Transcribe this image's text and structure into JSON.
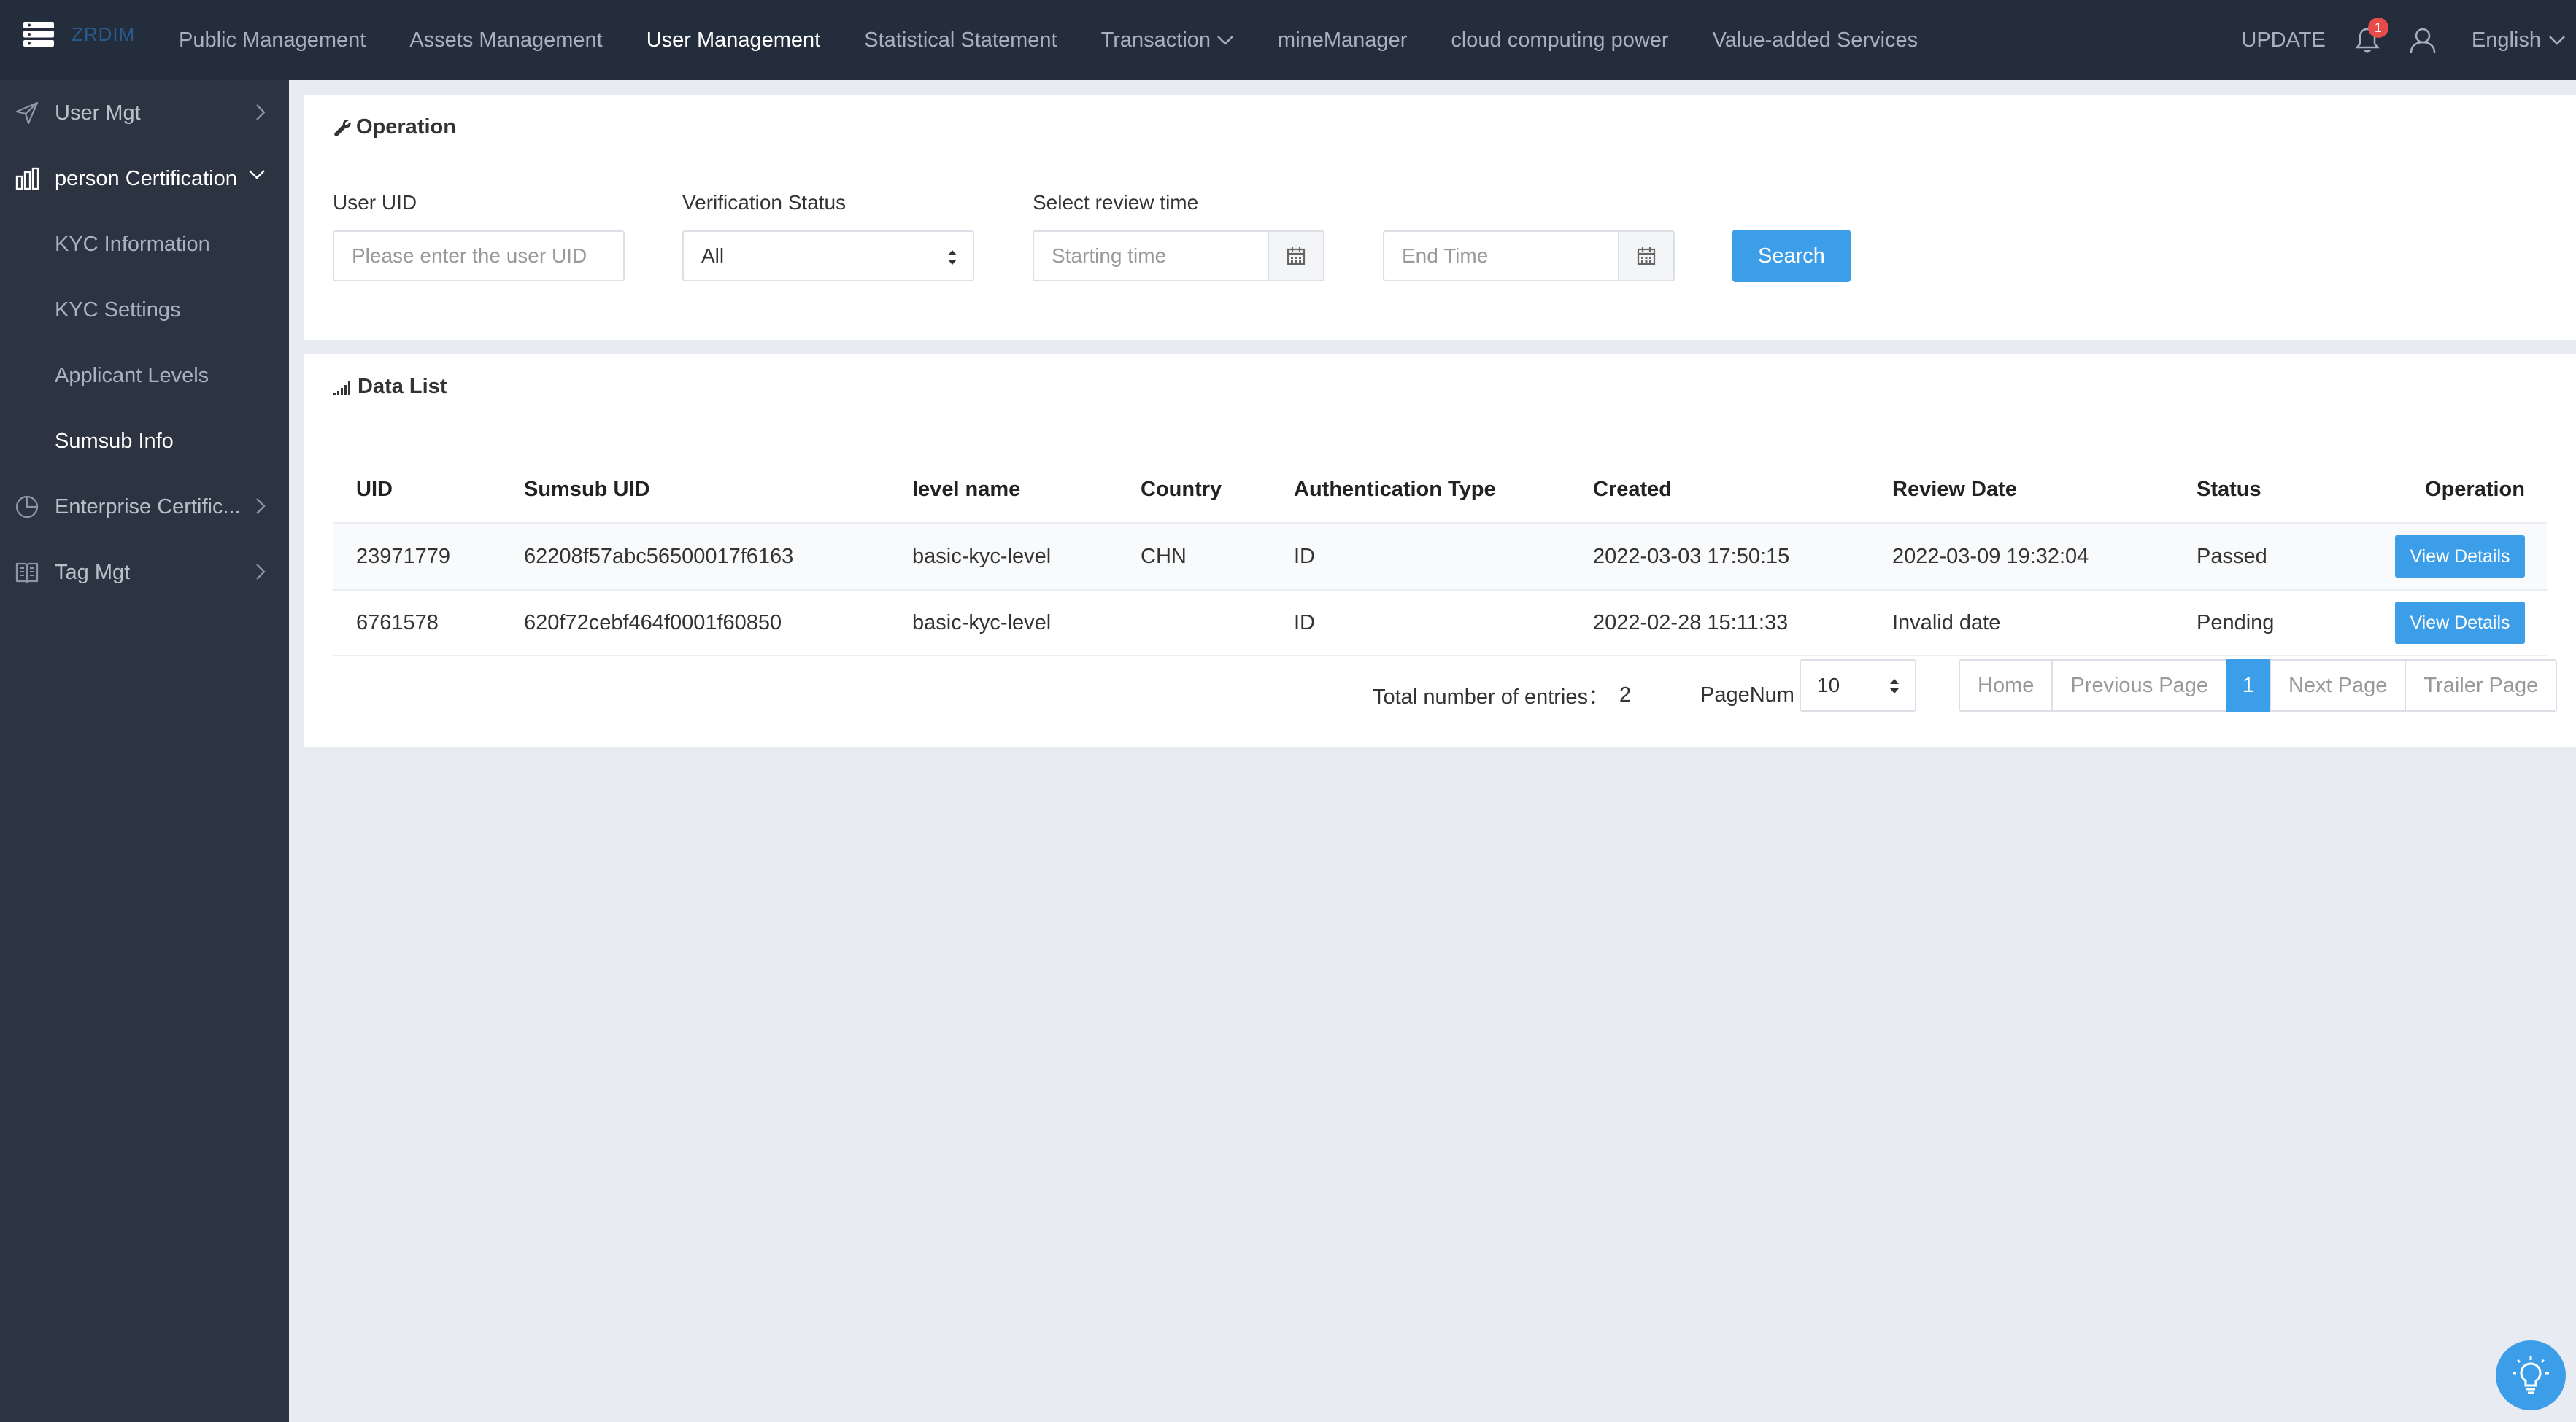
{
  "topbar": {
    "brand": "ZRDIM",
    "nav": [
      {
        "label": "Public Management"
      },
      {
        "label": "Assets Management"
      },
      {
        "label": "User Management"
      },
      {
        "label": "Statistical Statement"
      },
      {
        "label": "Transaction"
      },
      {
        "label": "mineManager"
      },
      {
        "label": "cloud computing power"
      },
      {
        "label": "Value-added Services"
      }
    ],
    "update_label": "UPDATE",
    "notification_count": "1",
    "language": "English"
  },
  "sidebar": {
    "items": [
      {
        "label": "User Mgt",
        "icon": "send-icon"
      },
      {
        "label": "person Certification",
        "icon": "bar-chart-icon"
      },
      {
        "label": "Enterprise Certific...",
        "icon": "pie-chart-icon"
      },
      {
        "label": "Tag Mgt",
        "icon": "book-icon"
      }
    ],
    "subitems": [
      {
        "label": "KYC Information"
      },
      {
        "label": "KYC Settings"
      },
      {
        "label": "Applicant Levels"
      },
      {
        "label": "Sumsub Info"
      }
    ]
  },
  "operation": {
    "title": "Operation",
    "uid_label": "User UID",
    "uid_placeholder": "Please enter the user UID",
    "status_label": "Verification Status",
    "status_value": "All",
    "time_label": "Select review time",
    "start_placeholder": "Starting time",
    "end_placeholder": "End Time",
    "search_label": "Search"
  },
  "data_list": {
    "title": "Data List",
    "columns": [
      "UID",
      "Sumsub UID",
      "level name",
      "Country",
      "Authentication Type",
      "Created",
      "Review Date",
      "Status",
      "Operation"
    ],
    "rows": [
      {
        "uid": "23971779",
        "sumsub_uid": "62208f57abc56500017f6163",
        "level": "basic-kyc-level",
        "country": "CHN",
        "auth_type": "ID",
        "created": "2022-03-03 17:50:15",
        "review_date": "2022-03-09 19:32:04",
        "status": "Passed",
        "action": "View Details"
      },
      {
        "uid": "6761578",
        "sumsub_uid": "620f72cebf464f0001f60850",
        "level": "basic-kyc-level",
        "country": "",
        "auth_type": "ID",
        "created": "2022-02-28 15:11:33",
        "review_date": "Invalid date",
        "status": "Pending",
        "action": "View Details"
      }
    ],
    "total_label": "Total number of entries：",
    "total_value": "2",
    "pagenum_label": "PageNum",
    "page_size": "10",
    "pager": {
      "home": "Home",
      "prev": "Previous Page",
      "current": "1",
      "next": "Next Page",
      "trailer": "Trailer Page"
    }
  },
  "colors": {
    "topbar": "#232d3b",
    "sidebar": "#2c3442",
    "accent": "#3c9de8",
    "badge": "#e84b4b"
  }
}
